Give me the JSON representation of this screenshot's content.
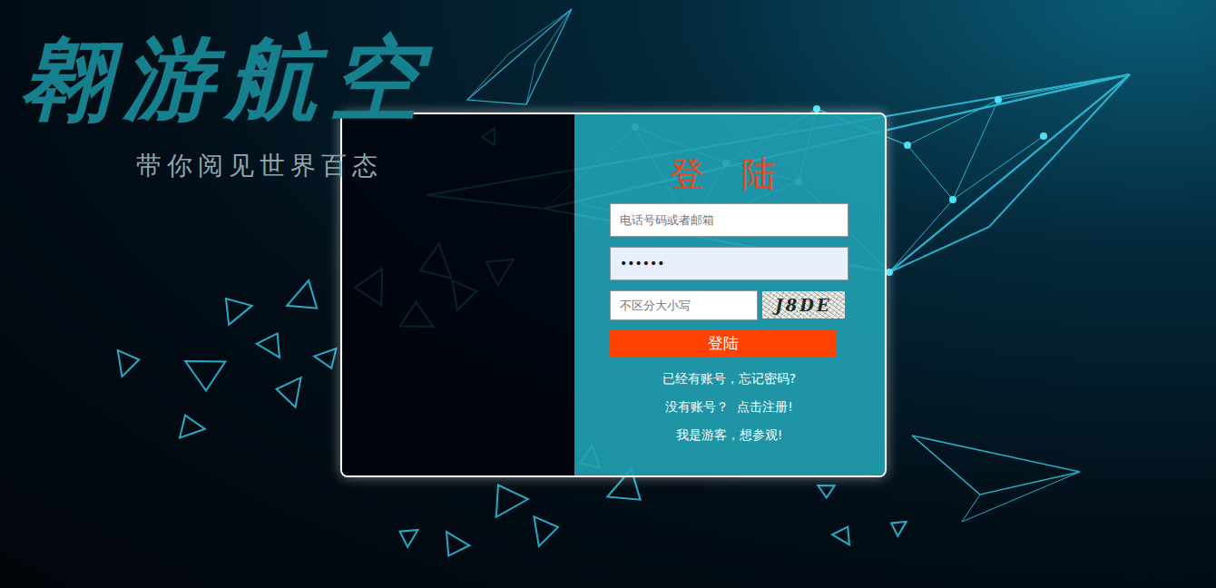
{
  "brand": {
    "title": "翱游航空",
    "slogan": "带你阅见世界百态"
  },
  "form": {
    "title": "登 陆",
    "account": {
      "placeholder": "电话号码或者邮箱",
      "value": ""
    },
    "password": {
      "value": "••••••"
    },
    "captcha": {
      "placeholder": "不区分大小写",
      "code": "J8DE"
    },
    "submit": "登陆",
    "links": [
      "已经有账号，忘记密码?",
      "没有账号？  点击注册!",
      "我是游客，想参观!"
    ]
  }
}
